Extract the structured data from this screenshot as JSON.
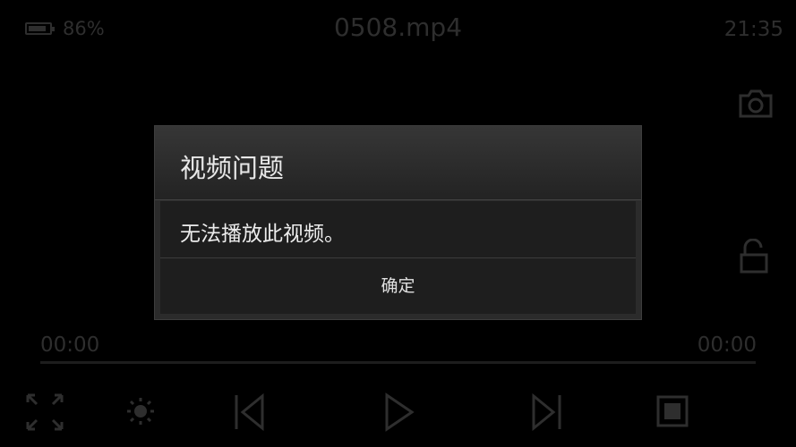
{
  "status_bar": {
    "battery_percent": "86%",
    "battery_level": 0.86,
    "title": "0508.mp4",
    "time": "21:35"
  },
  "player": {
    "elapsed": "00:00",
    "duration": "00:00",
    "progress": 0,
    "side_icons": [
      "camera-icon",
      "lock-open-icon"
    ],
    "controls": [
      "fullscreen-icon",
      "brightness-icon",
      "previous-icon",
      "play-icon",
      "next-icon",
      "stop-icon"
    ]
  },
  "dialog": {
    "title": "视频问题",
    "message": "无法播放此视频。",
    "ok_label": "确定"
  },
  "colors": {
    "background": "#000000",
    "dim_ui": "#2e2e2e",
    "dialog_bg": "#2b2b2b",
    "dialog_text": "#e8e8e8"
  }
}
